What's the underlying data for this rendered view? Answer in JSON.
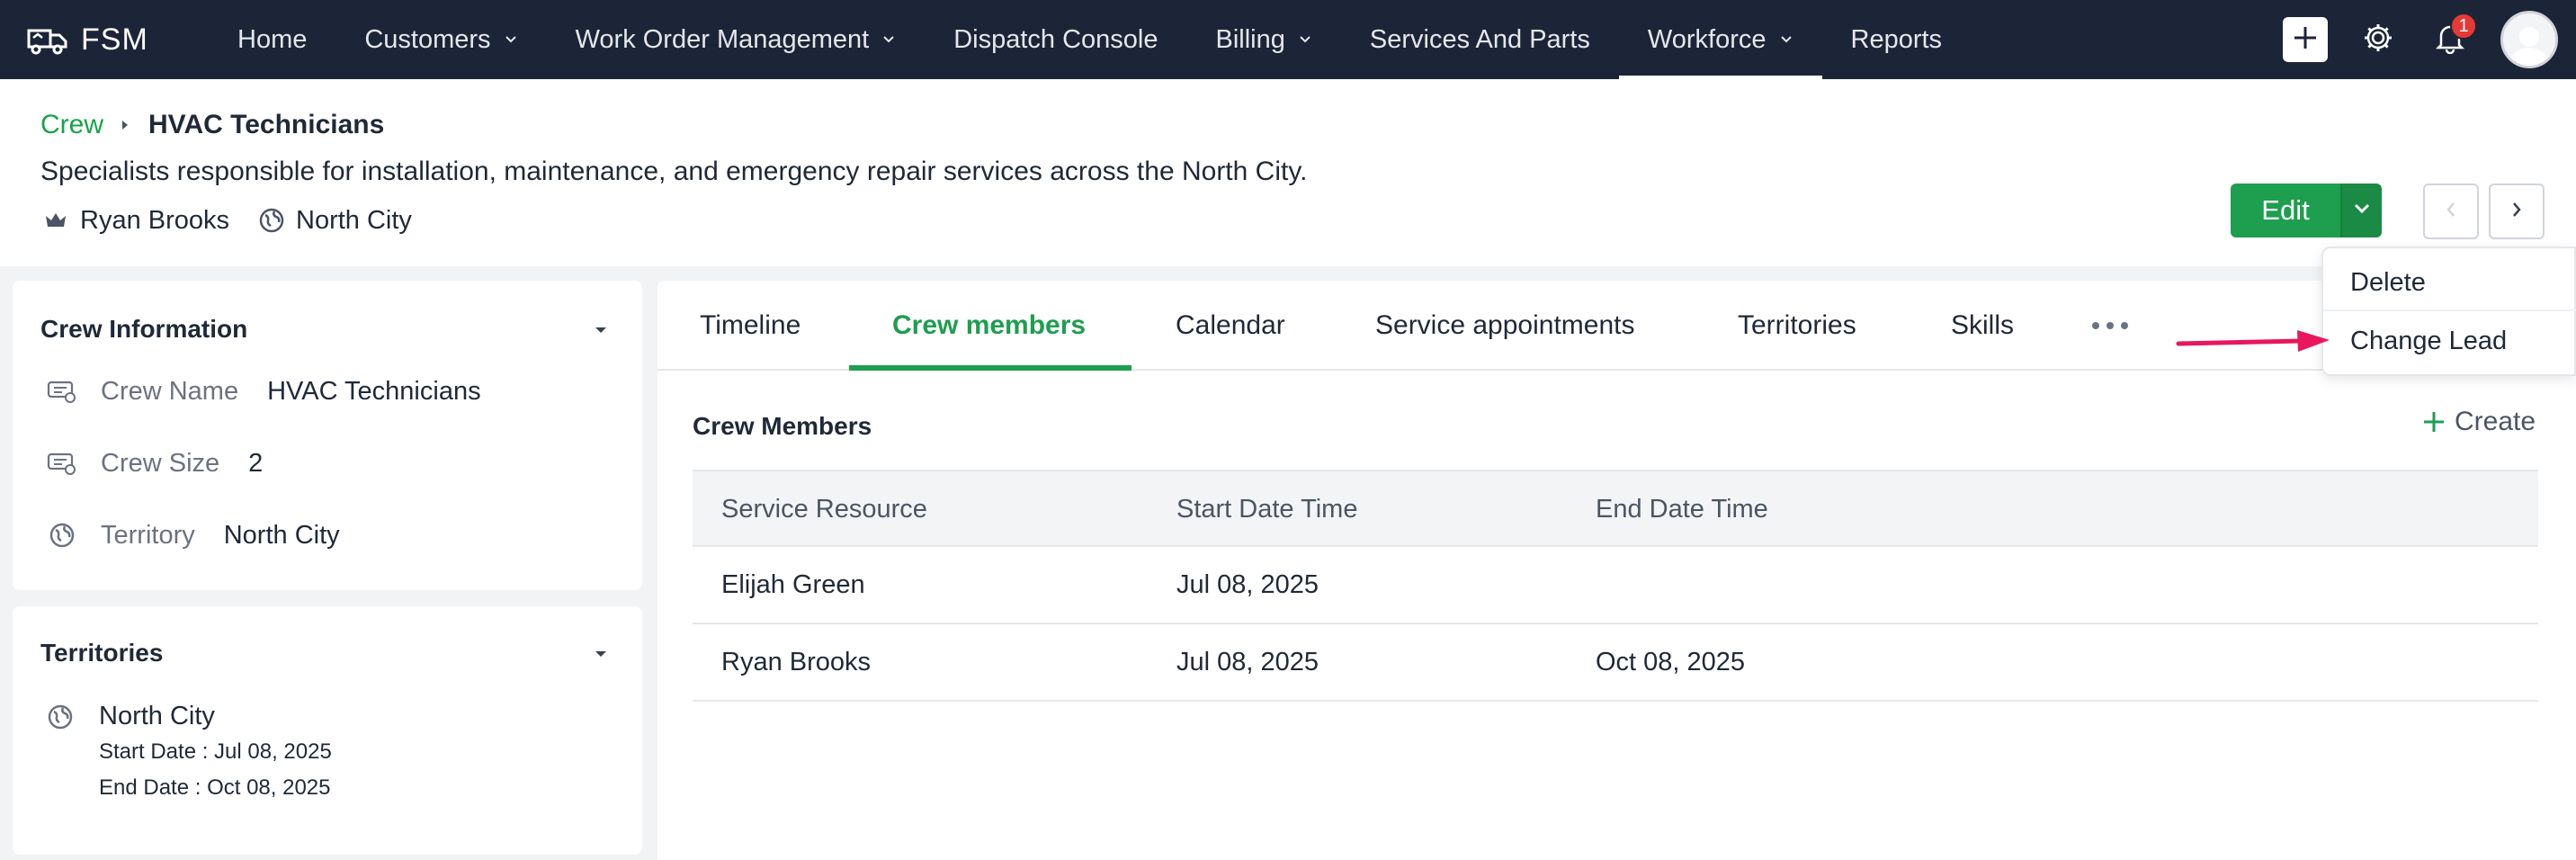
{
  "nav": {
    "brand": "FSM",
    "items": [
      {
        "label": "Home",
        "chevron": false,
        "active": false
      },
      {
        "label": "Customers",
        "chevron": true,
        "active": false
      },
      {
        "label": "Work Order Management",
        "chevron": true,
        "active": false
      },
      {
        "label": "Dispatch Console",
        "chevron": false,
        "active": false
      },
      {
        "label": "Billing",
        "chevron": true,
        "active": false
      },
      {
        "label": "Services And Parts",
        "chevron": false,
        "active": false
      },
      {
        "label": "Workforce",
        "chevron": true,
        "active": true
      },
      {
        "label": "Reports",
        "chevron": false,
        "active": false
      }
    ],
    "notification_count": "1"
  },
  "header": {
    "breadcrumb_parent": "Crew",
    "breadcrumb_current": "HVAC Technicians",
    "description": "Specialists responsible for installation, maintenance, and emergency repair services across the North City.",
    "lead": "Ryan Brooks",
    "territory": "North City",
    "edit_label": "Edit"
  },
  "crew_info": {
    "title": "Crew Information",
    "rows": [
      {
        "label": "Crew Name",
        "value": "HVAC Technicians",
        "icon": "tag-icon"
      },
      {
        "label": "Crew Size",
        "value": "2",
        "icon": "tag-icon"
      },
      {
        "label": "Territory",
        "value": "North City",
        "icon": "globe-icon"
      }
    ]
  },
  "territories": {
    "title": "Territories",
    "name": "North City",
    "start": "Start Date : Jul 08, 2025",
    "end": "End Date : Oct 08, 2025"
  },
  "tabs": [
    {
      "label": "Timeline",
      "active": false
    },
    {
      "label": "Crew members",
      "active": true
    },
    {
      "label": "Calendar",
      "active": false
    },
    {
      "label": "Service appointments",
      "active": false
    },
    {
      "label": "Territories",
      "active": false
    },
    {
      "label": "Skills",
      "active": false
    }
  ],
  "members": {
    "title": "Crew Members",
    "create_label": "Create",
    "columns": [
      "Service Resource",
      "Start Date Time",
      "End Date Time"
    ],
    "rows": [
      [
        "Elijah Green",
        "Jul 08, 2025",
        ""
      ],
      [
        "Ryan Brooks",
        "Jul 08, 2025",
        "Oct 08, 2025"
      ]
    ]
  },
  "dropdown": {
    "items": [
      "Delete",
      "Change Lead"
    ]
  },
  "colors": {
    "navbar": "#1c2537",
    "accent_green": "#1e9e4f",
    "link_green": "#16a34a",
    "badge_red": "#e53935",
    "arrow_pink": "#e8175d"
  }
}
